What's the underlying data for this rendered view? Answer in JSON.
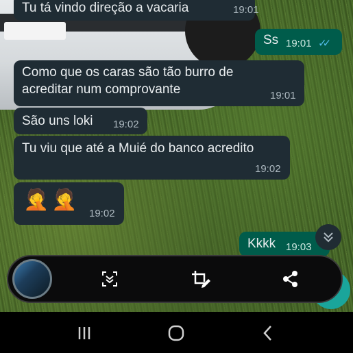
{
  "messages": [
    {
      "dir": "in",
      "text": "Tu tá vindo direção a vacaria",
      "time": "19:01"
    },
    {
      "dir": "out",
      "text": "Ss",
      "time": "19:01",
      "status": "read"
    },
    {
      "dir": "in",
      "text": "Como que os caras são tão burro de acreditar num comprovante",
      "time": "19:01"
    },
    {
      "dir": "in",
      "text": "São uns loki",
      "time": "19:02"
    },
    {
      "dir": "in",
      "text": "Tu viu que até a Muié do banco acredito",
      "time": "19:02"
    },
    {
      "dir": "in",
      "text": "🤦🤦",
      "time": "19:02"
    },
    {
      "dir": "out",
      "text": "Kkkk",
      "time": "19:03",
      "status": "read"
    }
  ],
  "colors": {
    "incoming": "#1f2c34",
    "outgoing": "#005c4b",
    "read_ticks": "#53bdeb",
    "accent": "#1aa59b"
  },
  "icons": {
    "scroll_down": "chevron-double-down-icon",
    "toolbar": [
      "screenshot-thumbnail",
      "scroll-capture-icon",
      "crop-edit-icon",
      "share-icon"
    ],
    "navbar": [
      "recent-apps-icon",
      "home-icon",
      "back-icon"
    ]
  }
}
